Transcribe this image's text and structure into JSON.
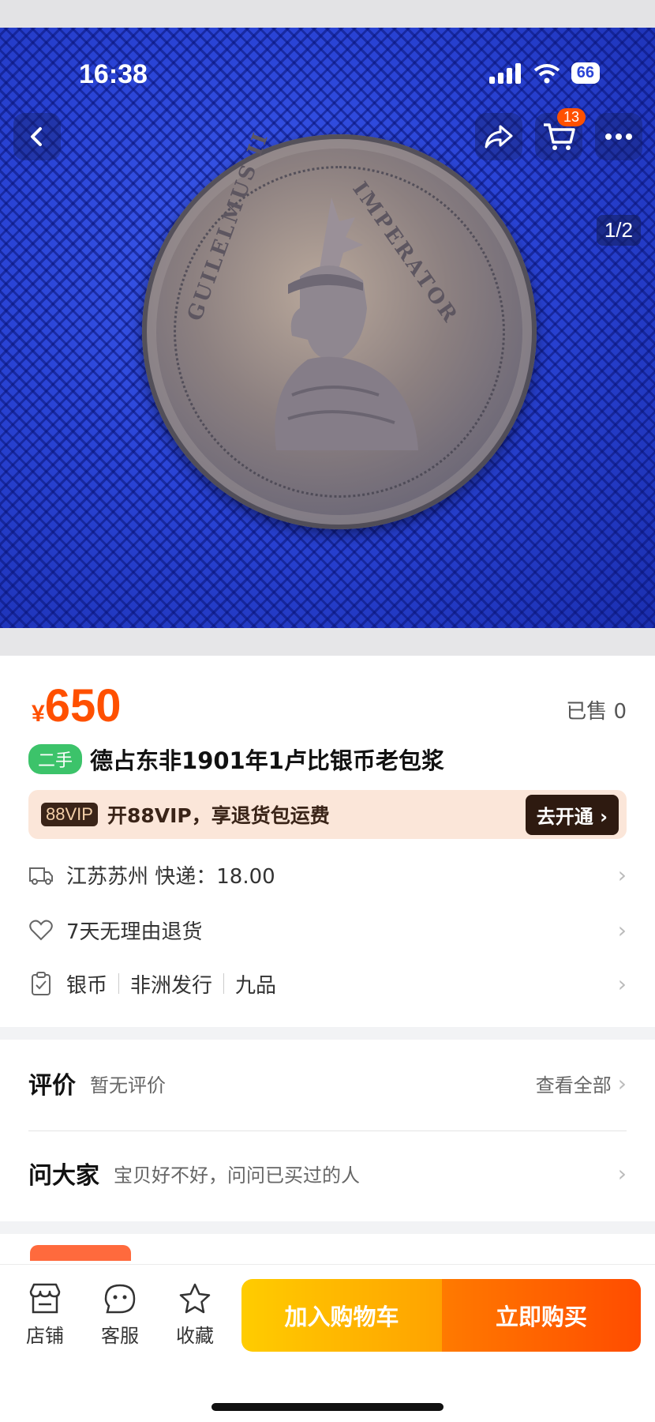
{
  "status_bar": {
    "time": "16:38",
    "battery": "66"
  },
  "hero": {
    "page_indicator": "1/2",
    "cart_count": "13",
    "coin_text_left": "GUILELMUS II",
    "coin_text_right": "IMPERATOR"
  },
  "product": {
    "currency": "¥",
    "price": "650",
    "sold": "已售 0",
    "tag": "二手",
    "title": "德占东非1901年1卢比银币老包浆"
  },
  "vip": {
    "badge": "88VIP",
    "text": "开88VIP，享退货包运费",
    "button": "去开通 ›"
  },
  "info_rows": {
    "shipping": "江苏苏州  快递：18.00",
    "returns": "7天无理由退货",
    "attrs": [
      "银币",
      "非洲发行",
      "九品"
    ]
  },
  "reviews": {
    "title": "评价",
    "sub": "暂无评价",
    "link": "查看全部"
  },
  "qa": {
    "title": "问大家",
    "sub": "宝贝好不好，问问已买过的人"
  },
  "bottom_bar": {
    "store": "店铺",
    "service": "客服",
    "favorite": "收藏",
    "add_cart": "加入购物车",
    "buy_now": "立即购买"
  },
  "colors": {
    "accent": "#ff5000",
    "used_tag": "#3cc36a",
    "cart_btn": "#ffb400",
    "buy_btn": "#ff5a00"
  }
}
